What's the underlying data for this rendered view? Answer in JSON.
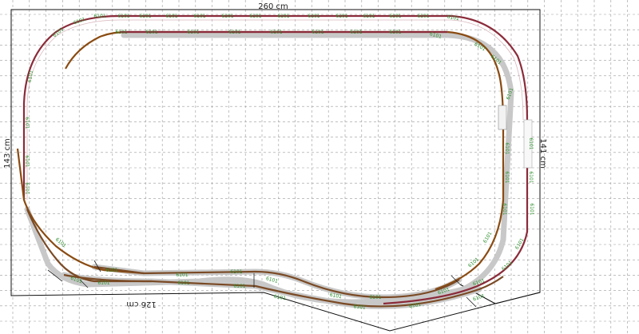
{
  "plan": {
    "dimensions": {
      "top": "260 cm",
      "left": "143 cm",
      "right": "141 cm",
      "bottom": "126 cm"
    },
    "piece_code": "6101",
    "colors": {
      "grid": "#9a9a9a",
      "outer_loop": "#8b2b3a",
      "inner_loop": "#8a4b12",
      "passing_track": "#7a4a25",
      "ballast": "#c8c8c8",
      "piece_label": "#2f8f2f",
      "board_edge": "#111111"
    }
  }
}
